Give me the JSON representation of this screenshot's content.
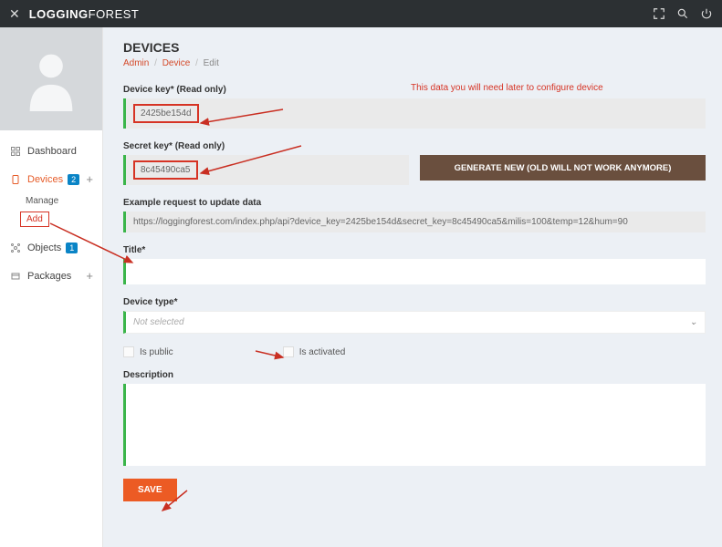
{
  "topbar": {
    "brand_bold": "LOGGING",
    "brand_light": "FOREST"
  },
  "sidebar": {
    "items": [
      {
        "label": "Dashboard"
      },
      {
        "label": "Devices",
        "badge": "2"
      },
      {
        "label": "Objects",
        "badge": "1"
      },
      {
        "label": "Packages"
      }
    ],
    "sub_manage": "Manage",
    "sub_add": "Add"
  },
  "page": {
    "title": "DEVICES",
    "crumb_admin": "Admin",
    "crumb_device": "Device",
    "crumb_edit": "Edit"
  },
  "form": {
    "device_key_label": "Device key* (Read only)",
    "device_key_value": "2425be154d",
    "note": "This data you will need later to configure device",
    "secret_key_label": "Secret key* (Read only)",
    "secret_key_value": "8c45490ca5",
    "generate_btn": "GENERATE NEW (OLD WILL NOT WORK ANYMORE)",
    "example_label": "Example request to update data",
    "example_value": "https://loggingforest.com/index.php/api?device_key=2425be154d&secret_key=8c45490ca5&milis=100&temp=12&hum=90",
    "title_label": "Title*",
    "device_type_label": "Device type*",
    "device_type_placeholder": "Not selected",
    "is_public": "Is public",
    "is_activated": "Is activated",
    "description_label": "Description",
    "save": "SAVE"
  }
}
